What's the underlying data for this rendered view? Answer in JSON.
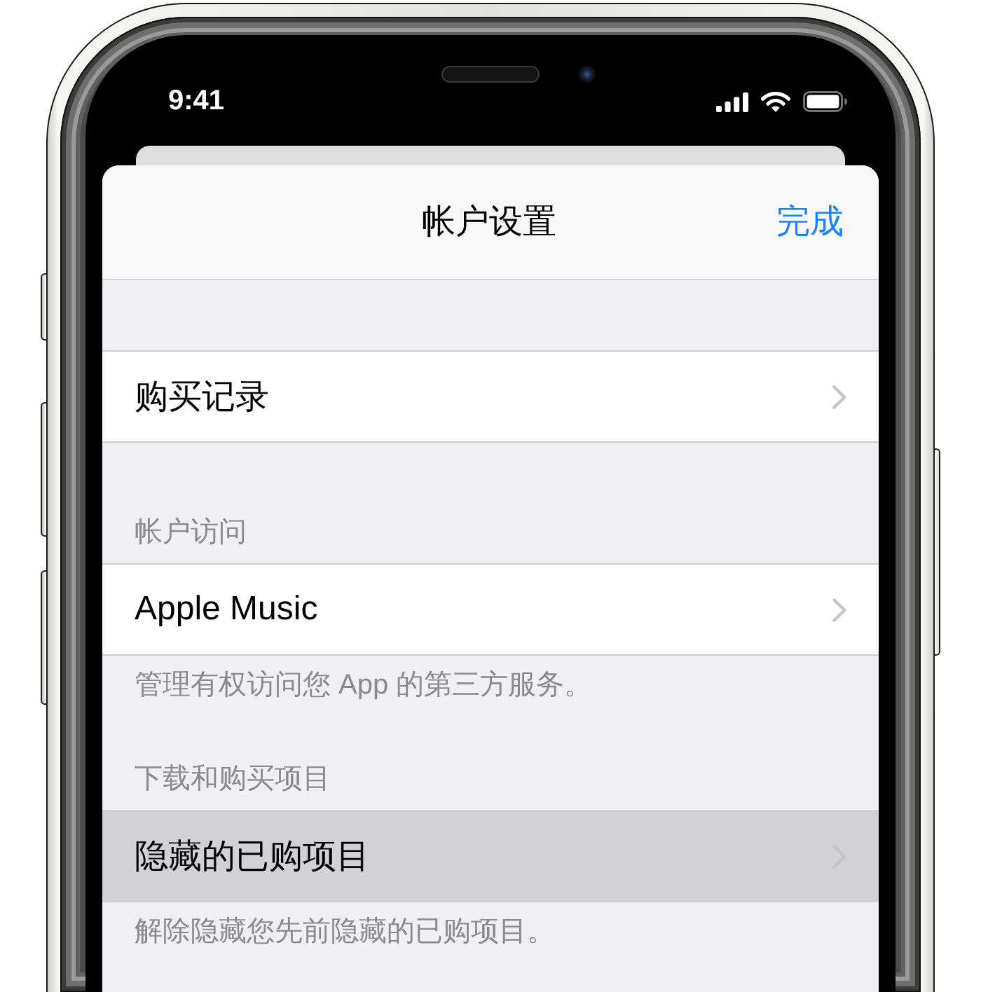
{
  "status_bar": {
    "time": "9:41"
  },
  "sheet": {
    "title": "帐户设置",
    "done_button": "完成",
    "sections": [
      {
        "rows": [
          {
            "label": "购买记录",
            "selected": false
          }
        ]
      },
      {
        "header": "帐户访问",
        "rows": [
          {
            "label": "Apple Music",
            "selected": false
          }
        ],
        "footer": "管理有权访问您 App 的第三方服务。"
      },
      {
        "header": "下载和购买项目",
        "rows": [
          {
            "label": "隐藏的已购项目",
            "selected": true
          }
        ],
        "footer": "解除隐藏您先前隐藏的已购项目。"
      }
    ]
  }
}
